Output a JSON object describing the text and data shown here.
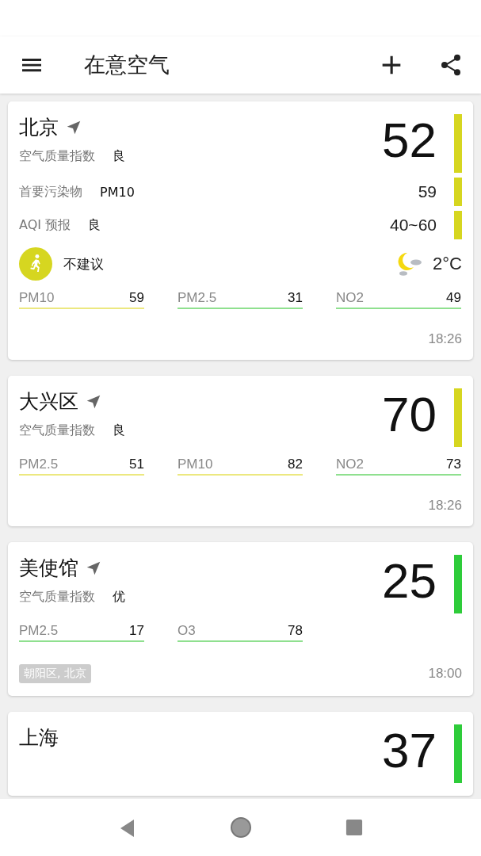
{
  "app_bar": {
    "title": "在意空气"
  },
  "cards": [
    {
      "name": "北京",
      "located": true,
      "index_label": "空气质量指数",
      "index_level": "良",
      "aqi": "52",
      "color": "#d6d620",
      "rows": [
        {
          "label": "首要污染物",
          "value": "PM10",
          "reading": "59",
          "color": "#d6d620"
        },
        {
          "label": "AQI 预报",
          "value": "良",
          "reading": "40~60",
          "color": "#d6d620"
        }
      ],
      "activity": {
        "text": "不建议",
        "color": "#d6d620"
      },
      "weather": {
        "temperature": "2°C"
      },
      "pollutants": [
        {
          "name": "PM10",
          "value": "59",
          "color": "#ece880"
        },
        {
          "name": "PM2.5",
          "value": "31",
          "color": "#8fe08f"
        },
        {
          "name": "NO2",
          "value": "49",
          "color": "#8fe08f"
        }
      ],
      "time": "18:26"
    },
    {
      "name": "大兴区",
      "located": true,
      "index_label": "空气质量指数",
      "index_level": "良",
      "aqi": "70",
      "color": "#d6d620",
      "pollutants": [
        {
          "name": "PM2.5",
          "value": "51",
          "color": "#ece880"
        },
        {
          "name": "PM10",
          "value": "82",
          "color": "#ece880"
        },
        {
          "name": "NO2",
          "value": "73",
          "color": "#8fe08f"
        }
      ],
      "time": "18:26"
    },
    {
      "name": "美使馆",
      "located": true,
      "index_label": "空气质量指数",
      "index_level": "优",
      "aqi": "25",
      "color": "#2ecc3a",
      "pollutants": [
        {
          "name": "PM2.5",
          "value": "17",
          "color": "#8fe08f"
        },
        {
          "name": "O3",
          "value": "78",
          "color": "#8fe08f"
        }
      ],
      "tag": "朝阳区, 北京",
      "time": "18:00"
    },
    {
      "name": "上海",
      "located": false,
      "aqi": "37",
      "color": "#2ecc3a"
    }
  ]
}
